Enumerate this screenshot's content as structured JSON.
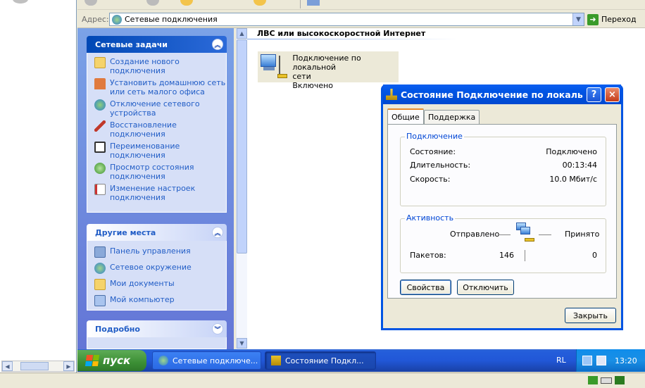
{
  "address": {
    "label": "Адрес:",
    "value": "Сетевые подключения",
    "go_label": "Переход"
  },
  "taskpane": {
    "network_tasks": {
      "title": "Сетевые задачи",
      "items": [
        {
          "label": "Создание нового подключения"
        },
        {
          "label": "Установить домашнюю сеть или сеть малого офиса"
        },
        {
          "label": "Отключение сетевого устройства"
        },
        {
          "label": "Восстановление подключения"
        },
        {
          "label": "Переименование подключения"
        },
        {
          "label": "Просмотр состояния подключения"
        },
        {
          "label": "Изменение настроек подключения"
        }
      ]
    },
    "other_places": {
      "title": "Другие места",
      "items": [
        {
          "label": "Панель управления"
        },
        {
          "label": "Сетевое окружение"
        },
        {
          "label": "Мои документы"
        },
        {
          "label": "Мой компьютер"
        }
      ]
    },
    "details": {
      "title": "Подробно"
    }
  },
  "content": {
    "section_title": "ЛВС или высокоскоростной Интернет",
    "connection": {
      "line1": "Подключение по локальной",
      "line2": "сети",
      "status": "Включено"
    }
  },
  "dialog": {
    "title": "Состояние Подключение по локальной...",
    "help": "?",
    "close": "×",
    "tabs": [
      "Общие",
      "Поддержка"
    ],
    "connection_group": {
      "label": "Подключение",
      "rows": [
        {
          "key": "Состояние:",
          "value": "Подключено"
        },
        {
          "key": "Длительность:",
          "value": "00:13:44"
        },
        {
          "key": "Скорость:",
          "value": "10.0 Мбит/с"
        }
      ]
    },
    "activity_group": {
      "label": "Активность",
      "sent_label": "Отправлено",
      "received_label": "Принято",
      "packets_label": "Пакетов:",
      "packets_sent": "146",
      "packets_received": "0"
    },
    "buttons": {
      "properties": "Свойства",
      "disable": "Отключить",
      "close": "Закрыть"
    }
  },
  "taskbar": {
    "start_label": "пуск",
    "tasks": [
      {
        "label": "Сетевые подключе..."
      },
      {
        "label": "Состояние Подкл..."
      }
    ],
    "lang": "RL",
    "clock": "13:20"
  },
  "colors": {
    "xp_blue": "#0054e3",
    "taskpane": "#6375d6",
    "start_green": "#3c8f35"
  }
}
